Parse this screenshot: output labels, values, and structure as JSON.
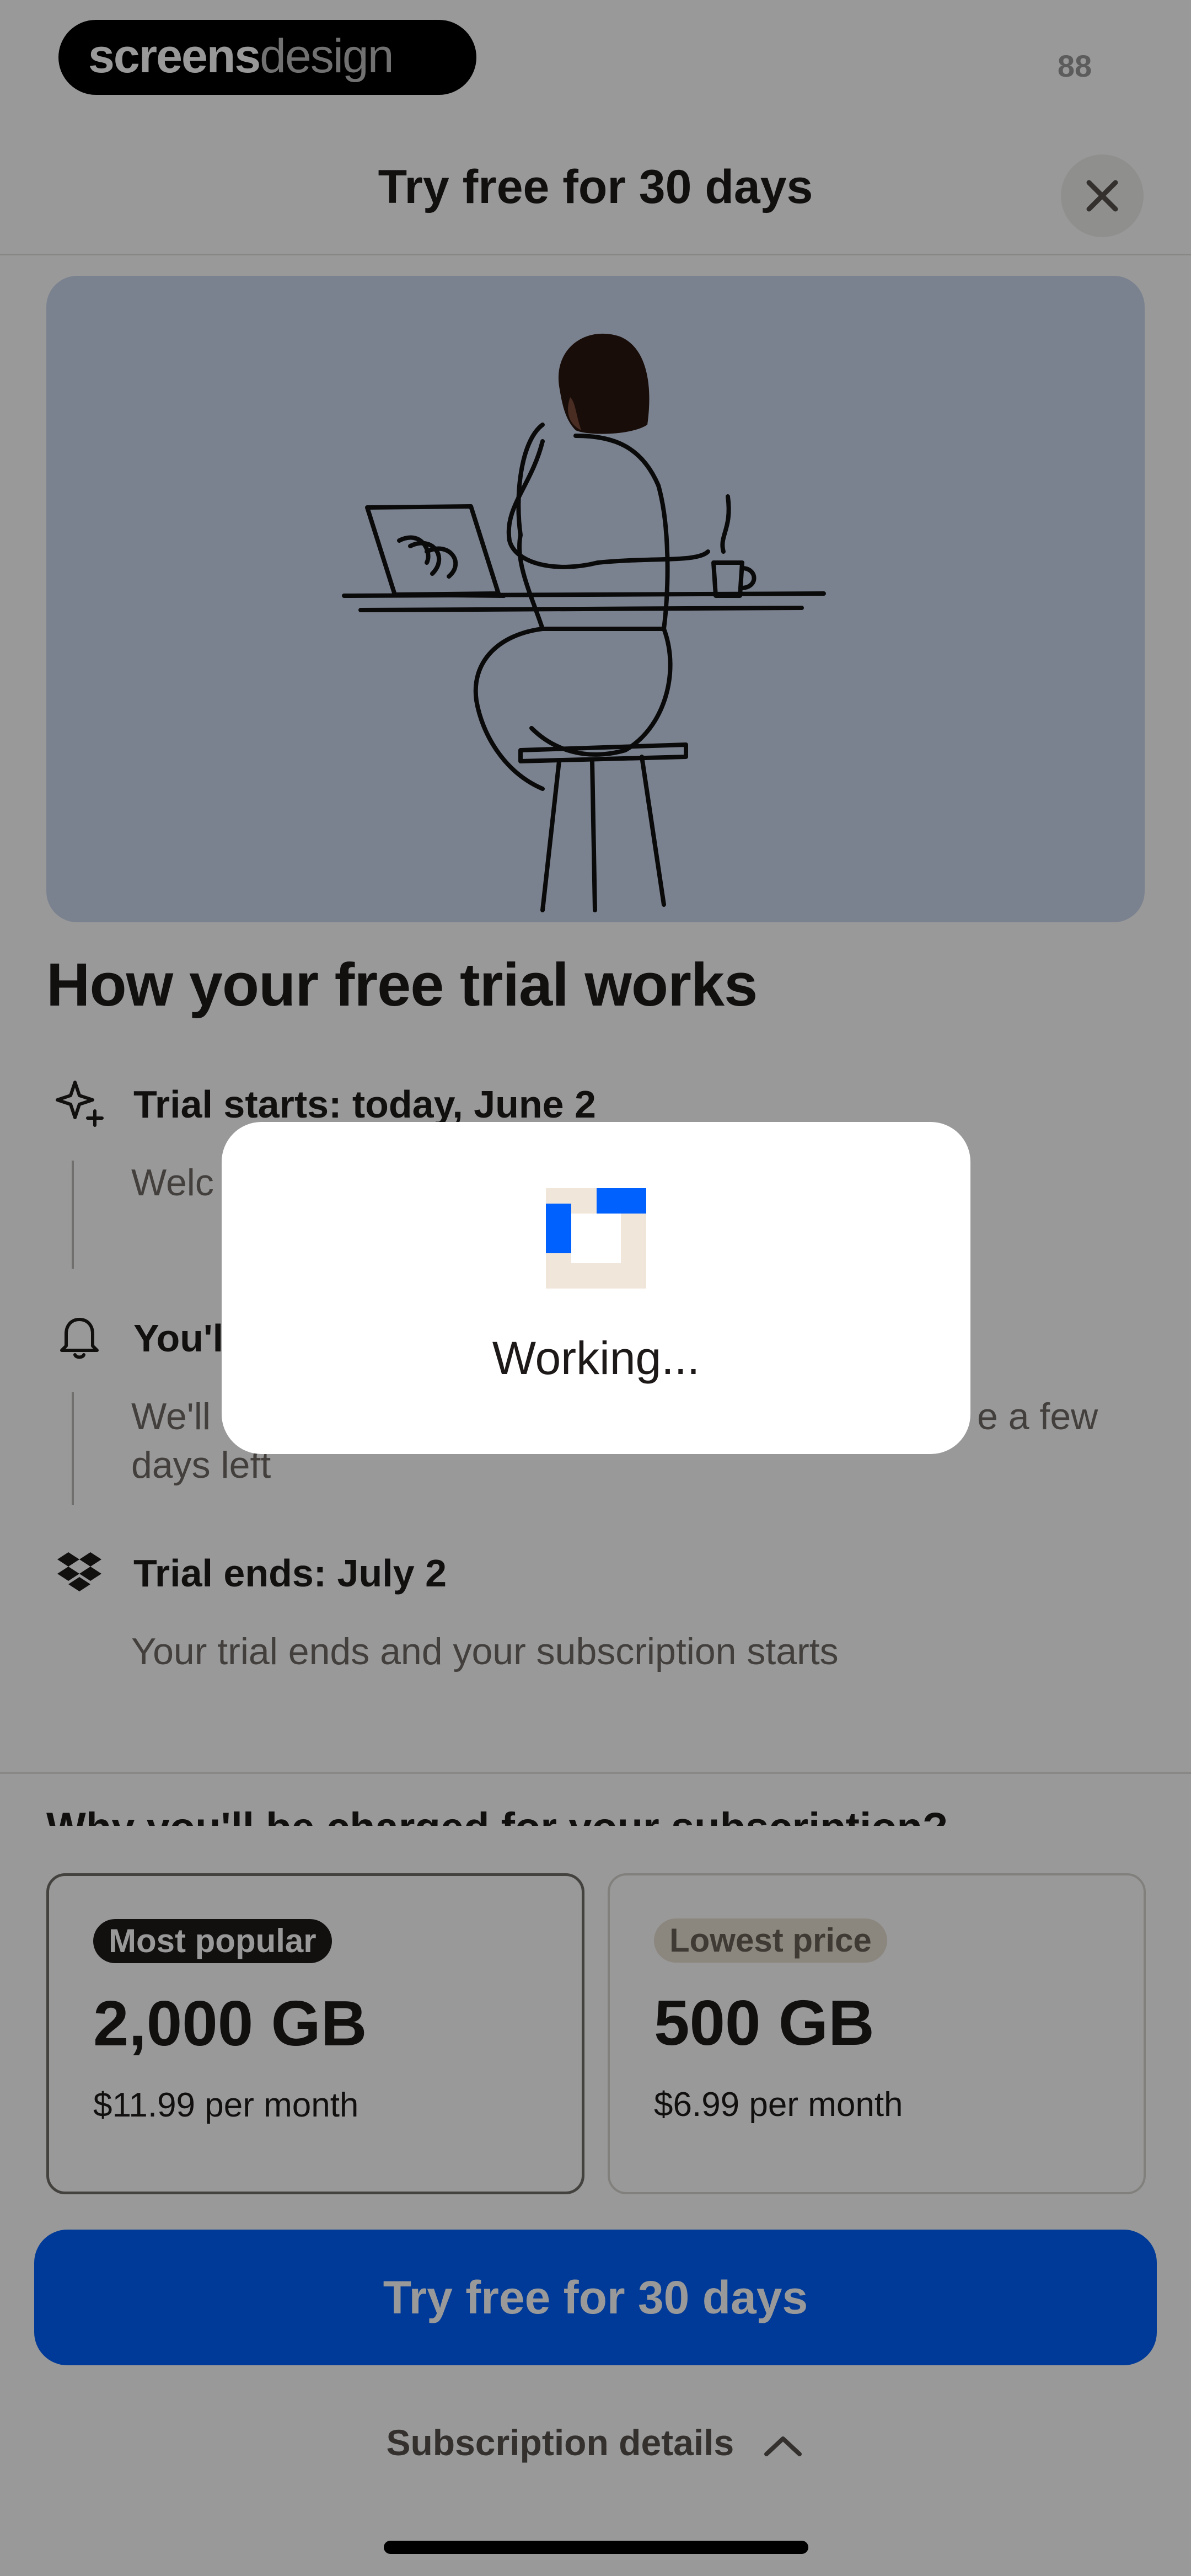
{
  "status_bar": {
    "brand_bold": "screens",
    "brand_light": "design",
    "battery": "88"
  },
  "header": {
    "title": "Try free for 30 days",
    "close_icon": "close-icon"
  },
  "hero": {
    "illustration": "woman-at-laptop-illustration"
  },
  "trial": {
    "title": "How your free trial works",
    "steps": [
      {
        "icon": "sparkle-icon",
        "title": "Trial starts: today, June 2",
        "text": "Welc"
      },
      {
        "icon": "bell-icon",
        "title": "You'l",
        "text_start": "We'll",
        "text_end": "e a few",
        "text_line2": "days left"
      },
      {
        "icon": "dropbox-icon",
        "title": "Trial ends: July 2",
        "text": "Your trial ends and your subscription starts"
      }
    ]
  },
  "peek_text": "Why you'll be charged for your subscription?",
  "plans": [
    {
      "badge": "Most popular",
      "size": "2,000 GB",
      "price": "$11.99 per month",
      "selected": true
    },
    {
      "badge": "Lowest price",
      "size": "500 GB",
      "price": "$6.99 per month",
      "selected": false
    }
  ],
  "cta": {
    "label": "Try free for 30 days"
  },
  "subscription_details": {
    "label": "Subscription details",
    "icon": "chevron-up-icon"
  },
  "modal": {
    "text": "Working..."
  },
  "colors": {
    "accent": "#0061fe",
    "hero_bg": "#cdd9ef",
    "overlay": "rgba(0,0,0,0.40)"
  }
}
